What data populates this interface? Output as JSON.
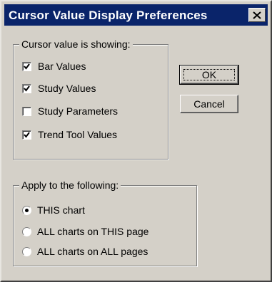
{
  "dialog": {
    "title": "Cursor Value Display Preferences",
    "close_icon": "close-x-icon"
  },
  "cursor_group": {
    "legend": "Cursor value is showing:",
    "options": [
      {
        "label": "Bar Values",
        "checked": true
      },
      {
        "label": "Study Values",
        "checked": true
      },
      {
        "label": "Study Parameters",
        "checked": false
      },
      {
        "label": "Trend Tool Values",
        "checked": true
      }
    ]
  },
  "apply_group": {
    "legend": "Apply to the following:",
    "options": [
      {
        "label": "THIS chart",
        "selected": true
      },
      {
        "label": "ALL charts on THIS page",
        "selected": false
      },
      {
        "label": "ALL charts on ALL pages",
        "selected": false
      }
    ]
  },
  "buttons": {
    "ok": "OK",
    "cancel": "Cancel"
  },
  "colors": {
    "titlebar": "#0a246a",
    "dialog_face": "#d4d0c8"
  }
}
